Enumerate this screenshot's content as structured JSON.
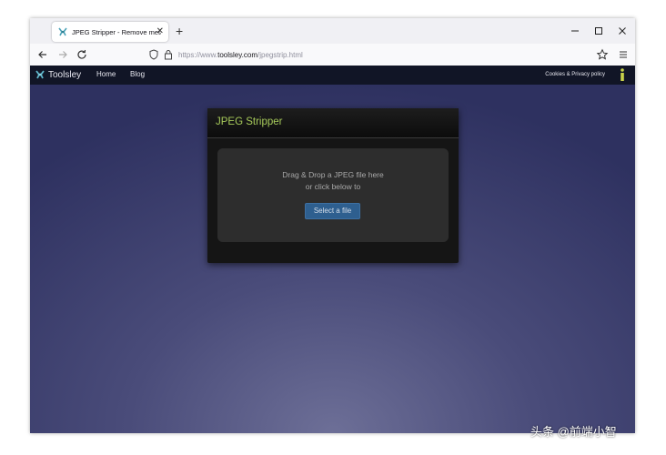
{
  "browser": {
    "tab_title": "JPEG Stripper - Remove metadata",
    "new_tab_label": "+",
    "tab_close_label": "✕",
    "url_prefix": "https://www.",
    "url_domain": "toolsley.com",
    "url_path": "/jpegstrip.html"
  },
  "site": {
    "brand": "Toolsley",
    "nav": [
      "Home",
      "Blog"
    ],
    "footer_link": "Cookies & Privacy policy"
  },
  "card": {
    "title": "JPEG Stripper",
    "drop_line1": "Drag & Drop a JPEG file here",
    "drop_line2": "or click below to",
    "select_button": "Select a file"
  },
  "watermark": "头条 @前端小智",
  "colors": {
    "title_green": "#a6c95a",
    "button_blue": "#2e5f8f",
    "site_bar": "#111526"
  }
}
